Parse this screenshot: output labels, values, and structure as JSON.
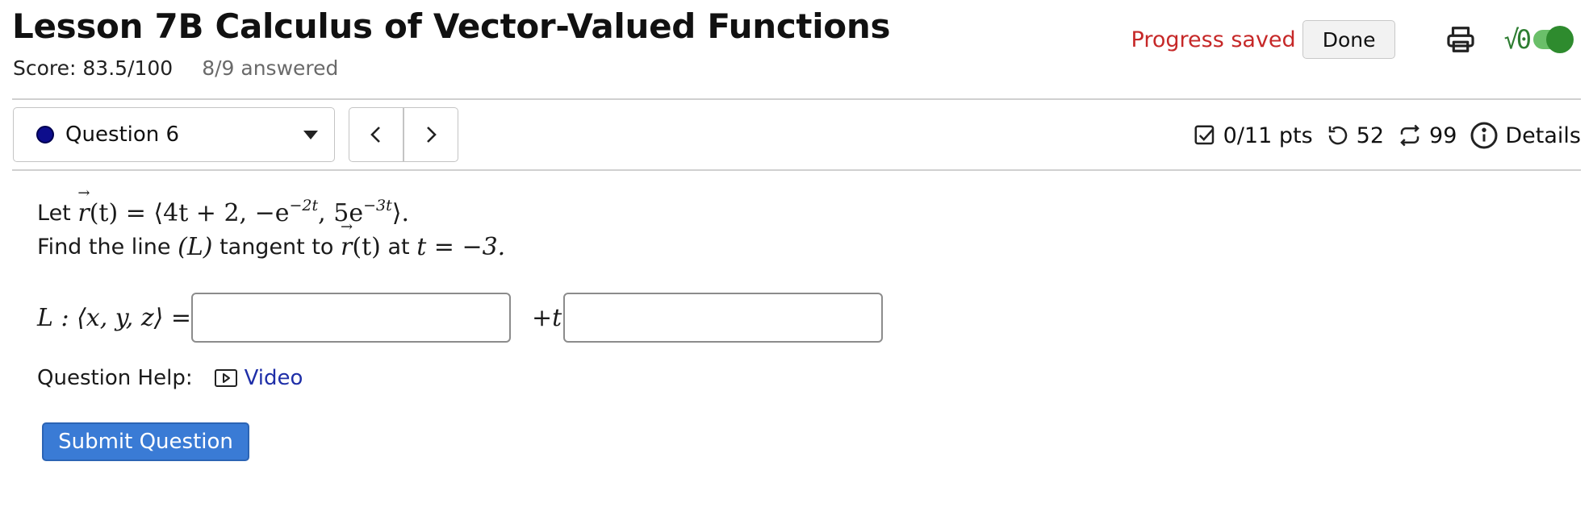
{
  "header": {
    "title": "Lesson 7B Calculus of Vector-Valued Functions",
    "score": "Score: 83.5/100",
    "answered": "8/9 answered"
  },
  "top_right": {
    "progress_status": "Progress saved",
    "done_label": "Done",
    "print_icon": "print-icon",
    "math_toggle_label": "√0",
    "math_toggle_on": true
  },
  "question_nav": {
    "selected_question": "Question 6",
    "status_color": "#0d0d8c",
    "prev_icon": "chevron-left-icon",
    "next_icon": "chevron-right-icon"
  },
  "stats": {
    "points": "0/11 pts",
    "retries": "52",
    "attempts": "99",
    "details_label": "Details"
  },
  "question": {
    "let_word": "Let",
    "r_name": "r",
    "t_var": "(t)",
    "equals": "=",
    "vector_part1": "⟨4t + 2, −e",
    "exp1": "−2t",
    "vector_part2": ", 5e",
    "exp2": "−3t",
    "vector_close": "⟩.",
    "find_text_1": "Find the line",
    "line_name": "(L)",
    "find_text_2": "tangent to",
    "at_word": "at",
    "t_equals": "t = −3."
  },
  "answer": {
    "lhs": "L : ⟨x, y, z⟩ =",
    "point_value": "",
    "plus_t": "+t",
    "direction_value": ""
  },
  "help": {
    "label": "Question Help:",
    "video_label": "Video"
  },
  "submit_label": "Submit Question"
}
